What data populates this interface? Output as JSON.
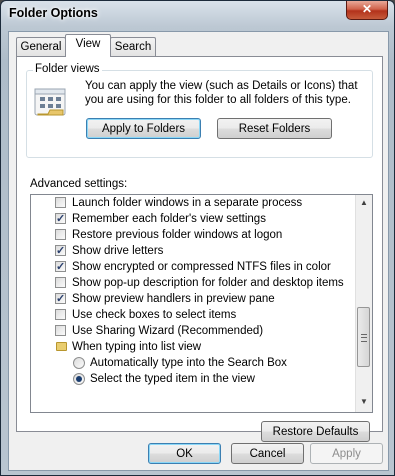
{
  "window": {
    "title": "Folder Options",
    "close_glyph": "✕"
  },
  "tabs": [
    {
      "label": "General",
      "active": false
    },
    {
      "label": "View",
      "active": true
    },
    {
      "label": "Search",
      "active": false
    }
  ],
  "folder_views": {
    "caption": "Folder views",
    "description": "You can apply the view (such as Details or Icons) that you are using for this folder to all folders of this type.",
    "icon": "folder-view-icon",
    "apply_label": "Apply to Folders",
    "reset_label": "Reset Folders"
  },
  "advanced": {
    "label": "Advanced settings:",
    "items": [
      {
        "type": "checkbox",
        "label": "Launch folder windows in a separate process",
        "checked": false
      },
      {
        "type": "checkbox",
        "label": "Remember each folder's view settings",
        "checked": true
      },
      {
        "type": "checkbox",
        "label": "Restore previous folder windows at logon",
        "checked": false
      },
      {
        "type": "checkbox",
        "label": "Show drive letters",
        "checked": true
      },
      {
        "type": "checkbox",
        "label": "Show encrypted or compressed NTFS files in color",
        "checked": true
      },
      {
        "type": "checkbox",
        "label": "Show pop-up description for folder and desktop items",
        "checked": false
      },
      {
        "type": "checkbox",
        "label": "Show preview handlers in preview pane",
        "checked": true
      },
      {
        "type": "checkbox",
        "label": "Use check boxes to select items",
        "checked": false
      },
      {
        "type": "checkbox",
        "label": "Use Sharing Wizard (Recommended)",
        "checked": false
      },
      {
        "type": "folder",
        "label": "When typing into list view"
      },
      {
        "type": "radio",
        "label": "Automatically type into the Search Box",
        "checked": false
      },
      {
        "type": "radio",
        "label": "Select the typed item in the view",
        "checked": true
      }
    ],
    "restore_defaults_label": "Restore Defaults"
  },
  "footer": {
    "ok_label": "OK",
    "cancel_label": "Cancel",
    "apply_label": "Apply"
  }
}
